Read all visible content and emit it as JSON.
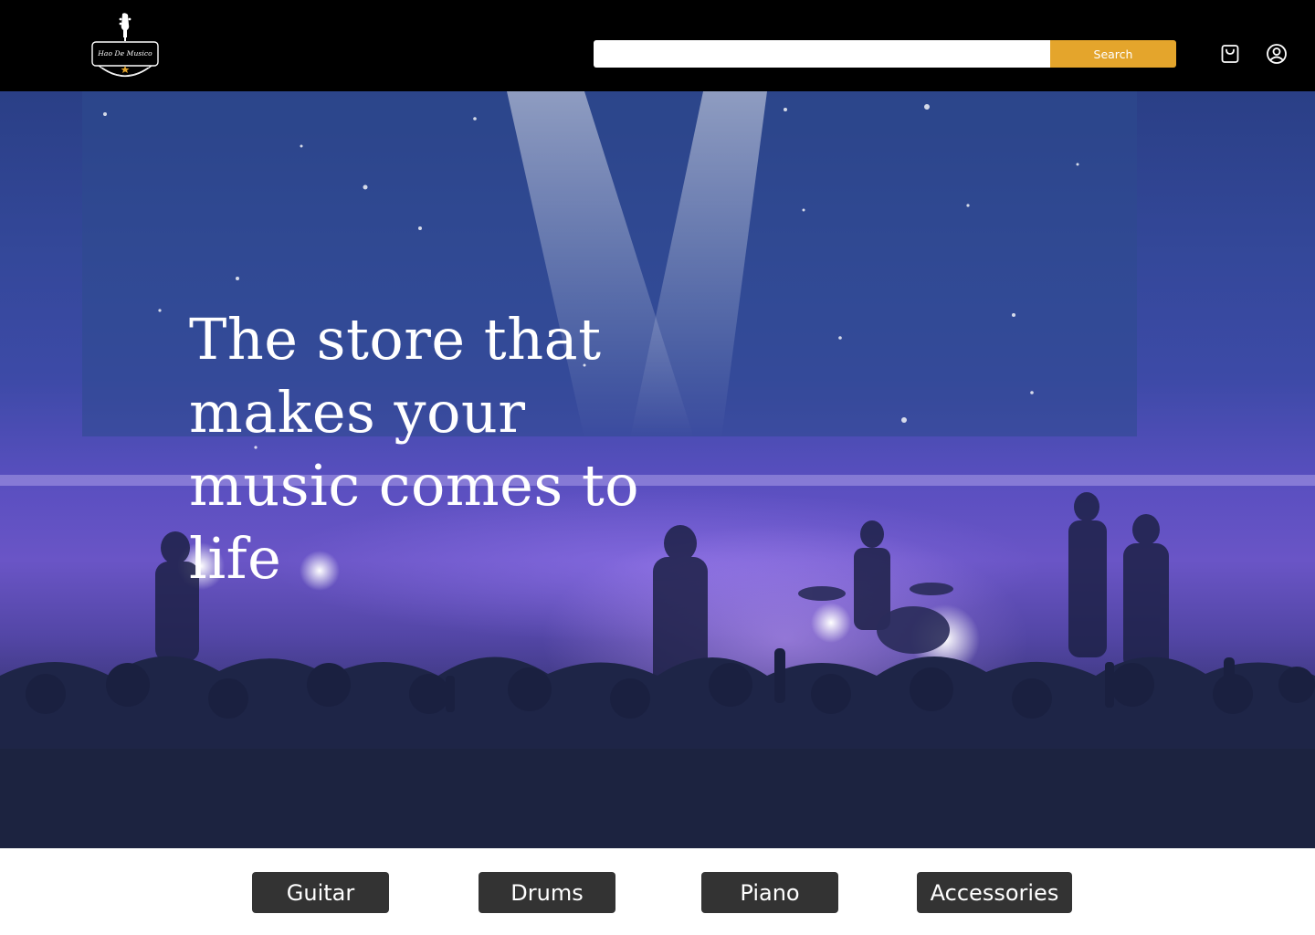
{
  "brand": {
    "logo_text": "Hao De Musico",
    "logo_icon": "guitar-headstock-icon"
  },
  "header": {
    "search": {
      "value": "",
      "placeholder": "",
      "button_label": "Search",
      "button_color": "#e4a52c"
    },
    "cart_icon": "shopping-bag-icon",
    "user_icon": "user-account-icon"
  },
  "hero": {
    "heading": "The store that makes your music comes to life"
  },
  "categories": {
    "items": [
      {
        "label": "Guitar"
      },
      {
        "label": "Drums"
      },
      {
        "label": "Piano"
      },
      {
        "label": "Accessories"
      }
    ]
  },
  "colors": {
    "header_bg": "#000000",
    "accent": "#e4a52c",
    "category_button_bg": "#333333",
    "hero_tint": "#4a4db8"
  }
}
